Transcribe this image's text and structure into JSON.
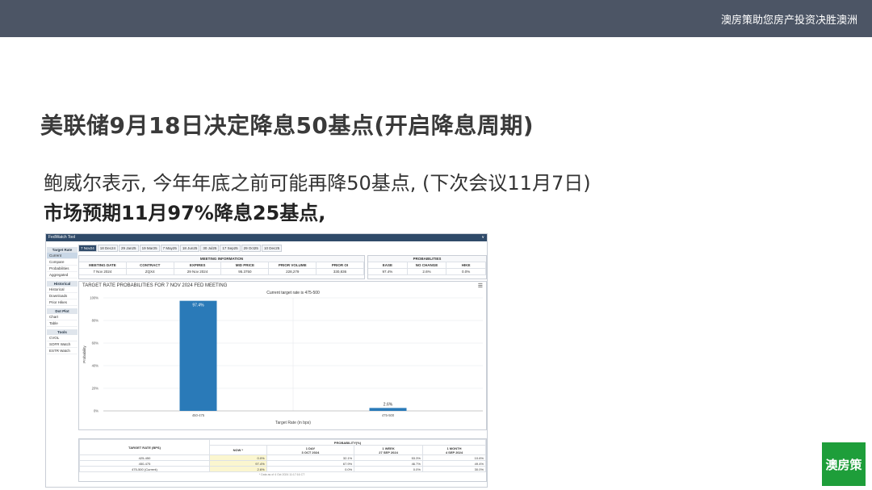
{
  "header": {
    "tagline": "澳房策助您房产投资决胜澳洲"
  },
  "slide": {
    "title": "美联储9月18日决定降息50基点(开启降息周期)",
    "line1": "鲍威尔表示, 今年年底之前可能再降50基点, (下次会议11月7日)",
    "line2": "市场预期11月97%降息25基点,"
  },
  "logo": {
    "text": "澳房策",
    "color": "#1e9e3a"
  },
  "tool": {
    "title": "FedWatch Tool",
    "sidebar": [
      {
        "group": "Target Rate",
        "items": [
          "Current",
          "Compare",
          "Probabilities",
          "Aggregated"
        ]
      },
      {
        "group": "Historical",
        "items": [
          "Historical",
          "Downloads",
          "Prior Hikes"
        ]
      },
      {
        "group": "Dot Plot",
        "items": [
          "Chart",
          "Table"
        ]
      },
      {
        "group": "Tools",
        "items": [
          "CVOL",
          "SOFR Watch",
          "ESTR Watch"
        ]
      }
    ],
    "tabs": [
      "7 Nov24",
      "18 Dec24",
      "29 Jan25",
      "19 Mar25",
      "7 May25",
      "18 Jun25",
      "30 Jul25",
      "17 Sep25",
      "29 Oct25",
      "10 Dec25"
    ],
    "meeting_info": {
      "title": "MEETING INFORMATION",
      "headers": [
        "MEETING DATE",
        "CONTRACT",
        "EXPIRES",
        "MID PRICE",
        "PRIOR VOLUME",
        "PRIOR OI"
      ],
      "values": [
        "7 Nov 2024",
        "ZQX4",
        "29 Nov 2024",
        "95.3750",
        "228,279",
        "330,836"
      ]
    },
    "probabilities": {
      "title": "PROBABILITIES",
      "headers": [
        "EASE",
        "NO CHANGE",
        "HIKE"
      ],
      "values": [
        "97.4%",
        "2.6%",
        "0.0%"
      ]
    },
    "chart_header": "TARGET RATE PROBABILITIES FOR 7 NOV 2024 FED MEETING",
    "chart_menu_icon": "hamburger-menu-icon",
    "bottom_table": {
      "group_header": "PROBABILITY(%)",
      "row_header": "TARGET RATE (BPS)",
      "col_headers": [
        {
          "line1": "NOW *",
          "line2": ""
        },
        {
          "line1": "1 DAY",
          "line2": "3 OCT 2024"
        },
        {
          "line1": "1 WEEK",
          "line2": "27 SEP 2024"
        },
        {
          "line1": "1 MONTH",
          "line2": "4 SEP 2024"
        }
      ],
      "rows": [
        {
          "rate": "425-450",
          "now": "0.0%",
          "d1": "32.1%",
          "w1": "53.3%",
          "m1": "10.6%"
        },
        {
          "rate": "450-475",
          "now": "97.4%",
          "d1": "67.9%",
          "w1": "46.7%",
          "m1": "49.4%"
        },
        {
          "rate": "475-500 (Current)",
          "now": "2.6%",
          "d1": "0.0%",
          "w1": "0.0%",
          "m1": "30.0%"
        }
      ],
      "footnote": "* Data as of 4 Oct 2024 11:17:16 CT"
    }
  },
  "chart_data": {
    "type": "bar",
    "title": "Current target rate is 475-500",
    "xlabel": "Target Rate (in bps)",
    "ylabel": "Probability",
    "categories": [
      "450-475",
      "475-500"
    ],
    "values": [
      97.4,
      2.6
    ],
    "data_labels": [
      "97.4%",
      "2.6%"
    ],
    "y_ticks": [
      "0%",
      "20%",
      "40%",
      "60%",
      "80%",
      "100%"
    ],
    "ylim": [
      0,
      100
    ],
    "bar_color": "#2a7ab8",
    "grid": true
  }
}
